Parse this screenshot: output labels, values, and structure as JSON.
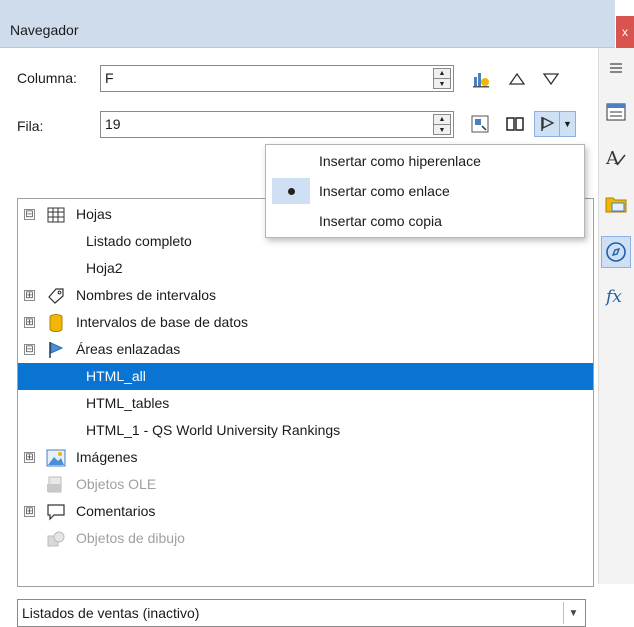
{
  "window": {
    "title": "Navegador",
    "close_glyph": "x"
  },
  "fields": {
    "column": {
      "label": "Columna:",
      "value": "F"
    },
    "row": {
      "label": "Fila:",
      "value": "19"
    }
  },
  "tree": {
    "items": [
      {
        "label": "Hojas",
        "icon": "sheet-grid-icon",
        "expander": "⊟"
      },
      {
        "label": "Listado completo"
      },
      {
        "label": "Hoja2"
      },
      {
        "label": "Nombres de intervalos",
        "icon": "range-tag-icon",
        "expander": "⊞"
      },
      {
        "label": "Intervalos de base de datos",
        "icon": "database-icon",
        "expander": "⊞"
      },
      {
        "label": "Áreas enlazadas",
        "icon": "flag-icon",
        "expander": "⊟"
      },
      {
        "label": "HTML_all",
        "selected": true
      },
      {
        "label": "HTML_tables"
      },
      {
        "label": "HTML_1 - QS World University Rankings"
      },
      {
        "label": "Imágenes",
        "icon": "image-icon",
        "expander": "⊞"
      },
      {
        "label": "Objetos OLE",
        "icon": "ole-object-icon",
        "disabled": true
      },
      {
        "label": "Comentarios",
        "icon": "comment-icon",
        "expander": "⊞"
      },
      {
        "label": "Objetos de dibujo",
        "icon": "drawing-object-icon",
        "disabled": true
      }
    ]
  },
  "drag_mode_menu": {
    "items": [
      {
        "label": "Insertar como hiperenlace",
        "checked": false
      },
      {
        "label": "Insertar como enlace",
        "checked": true
      },
      {
        "label": "Insertar como copia",
        "checked": false
      }
    ]
  },
  "document_select": {
    "value": "Listados de ventas (inactivo)"
  },
  "colors": {
    "selection": "#0a74d3",
    "title_bar": "#cfdcec",
    "pressed": "#cfe0f5"
  }
}
